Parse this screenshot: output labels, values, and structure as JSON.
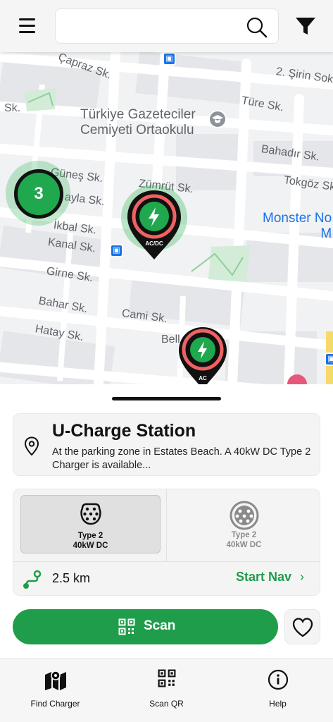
{
  "header": {
    "search": {
      "value": "",
      "placeholder": ""
    },
    "menu_icon": "hamburger-icon",
    "search_icon": "search-icon",
    "filter_icon": "funnel-icon"
  },
  "map": {
    "streets": [
      "Çapraz Sk.",
      "Sk.",
      "2. Şirin Sok",
      "Türe Sk.",
      "Bahadır Sk.",
      "Tokgöz Sk",
      "Güneş Sk.",
      "ayla Sk.",
      "Zümrüt Sk.",
      "İkbal Sk.",
      "Kanal Sk.",
      "Girne Sk.",
      "Bahar Sk.",
      "Cami Sk.",
      "Hatay Sk.",
      "Bell"
    ],
    "poi_school_line1": "Türkiye Gazeteciler",
    "poi_school_line2": "Cemiyeti Ortaokulu",
    "poi_monster_line1": "Monster No",
    "poi_monster_line2": "M",
    "cluster_count": "3",
    "pins": [
      {
        "label": "AC/DC",
        "icon": "lightning-icon"
      },
      {
        "label": "AC",
        "icon": "lightning-icon"
      }
    ]
  },
  "station": {
    "name": "U-Charge Station",
    "description": "At the parking zone in Estates Beach. A 40kW DC Type 2 Charger is available...",
    "connectors": [
      {
        "type": "Type 2",
        "power": "40kW DC",
        "selected": true
      },
      {
        "type": "Type 2",
        "power": "40kW DC",
        "selected": false
      }
    ],
    "distance": "2.5 km",
    "start_nav": "Start Nav",
    "scan_label": "Scan"
  },
  "tabs": [
    {
      "label": "Find Charger",
      "icon": "map-icon"
    },
    {
      "label": "Scan QR",
      "icon": "qr-code-icon"
    },
    {
      "label": "Help",
      "icon": "info-icon"
    }
  ],
  "colors": {
    "accent": "#1f9d4b",
    "pin_ring": "#f06262",
    "map_bg": "#f1f2f4"
  }
}
